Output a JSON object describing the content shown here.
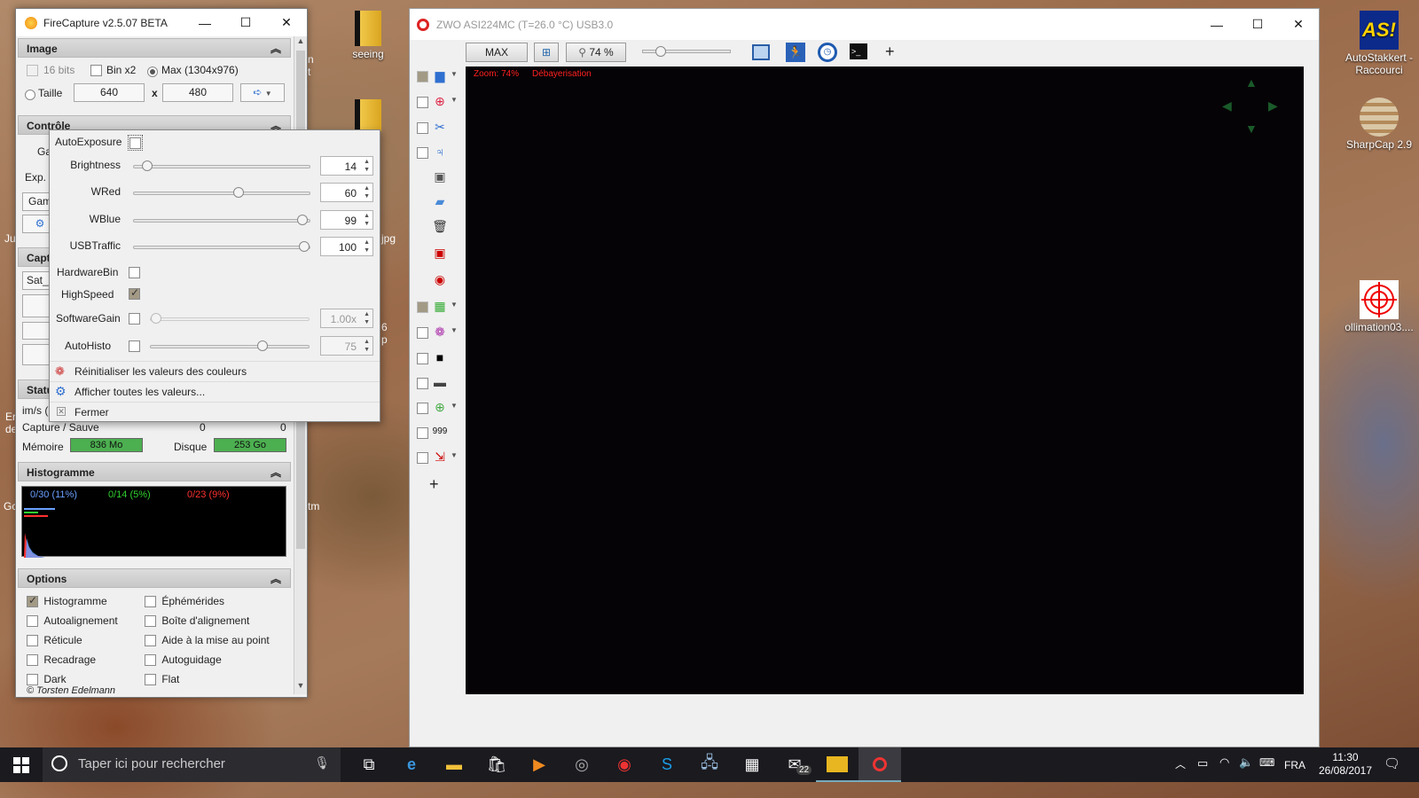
{
  "desktop": {
    "icons": [
      {
        "label": "seeing"
      },
      {
        "label": "AutoStakkert - Raccourci"
      },
      {
        "label": "SharpCap 2.9"
      },
      {
        "label": "ollimation03...."
      }
    ],
    "partial_labels": {
      "n": "n",
      "t": "t",
      "jpg": "jpg",
      "six": "6",
      "p": "p",
      "tm": "tm",
      "Ju": "Ju",
      "Er": "Er",
      "de": "de",
      "Gc": "Gc"
    }
  },
  "firecapture": {
    "title": "FireCapture v2.5.07 BETA",
    "image_section": {
      "header": "Image",
      "bits_label": "16 bits",
      "bin_label": "Bin x2",
      "max_label": "Max (1304x976)",
      "taille_label": "Taille",
      "width": "640",
      "x_label": "x",
      "height": "480"
    },
    "controle_section": {
      "header": "Contrôle",
      "ga_label": "Ga",
      "exp_label": "Exp.",
      "gam_label": "Gam"
    },
    "capture_section": {
      "header": "Capt",
      "profile": "Sat_"
    },
    "status_section": {
      "header": "Statu",
      "ims_label": "im/s (",
      "capture_label": "Capture / Sauve",
      "capture_val1": "0",
      "capture_val2": "0",
      "memoire_label": "Mémoire",
      "memoire_val": "836 Mo",
      "disque_label": "Disque",
      "disque_val": "253 Go"
    },
    "histogram_section": {
      "header": "Histogramme",
      "blue_text": "0/30 (11%)",
      "green_text": "0/14 (5%)",
      "red_text": "0/23 (9%)"
    },
    "options_section": {
      "header": "Options",
      "items": [
        {
          "label": "Histogramme",
          "checked": true
        },
        {
          "label": "Éphémérides",
          "checked": false
        },
        {
          "label": "Autoalignement",
          "checked": false
        },
        {
          "label": "Boîte d'alignement",
          "checked": false
        },
        {
          "label": "Réticule",
          "checked": false
        },
        {
          "label": "Aide à la mise au point",
          "checked": false
        },
        {
          "label": "Recadrage",
          "checked": false
        },
        {
          "label": "Autoguidage",
          "checked": false
        },
        {
          "label": "Dark",
          "checked": false
        },
        {
          "label": "Flat",
          "checked": false
        }
      ],
      "copyright": "© Torsten Edelmann"
    }
  },
  "popup": {
    "autoexposure_label": "AutoExposure",
    "rows": [
      {
        "label": "Brightness",
        "value": "14",
        "level": 0.05
      },
      {
        "label": "WRed",
        "value": "60",
        "level": 0.6
      },
      {
        "label": "WBlue",
        "value": "99",
        "level": 0.99
      },
      {
        "label": "USBTraffic",
        "value": "100",
        "level": 1.0
      }
    ],
    "hardwarebin_label": "HardwareBin",
    "highspeed_label": "HighSpeed",
    "softwaregain_label": "SoftwareGain",
    "softwaregain_value": "1.00x",
    "autohisto_label": "AutoHisto",
    "autohisto_value": "75",
    "menu": [
      {
        "label": "Réinitialiser les valeurs des couleurs"
      },
      {
        "label": "Afficher toutes les valeurs..."
      },
      {
        "label": "Fermer"
      }
    ]
  },
  "zwo": {
    "title": "ZWO ASI224MC (T=26.0 °C) USB3.0",
    "max_label": "MAX",
    "zoom_label": "74 %",
    "zoom_overlay": "Zoom: 74%",
    "debayer_overlay": "Débayerisation",
    "compass": {
      "n": "N",
      "s": "S",
      "e": "E",
      "w": "W"
    }
  },
  "taskbar": {
    "search_placeholder": "Taper ici pour rechercher",
    "mail_badge": "22",
    "language": "FRA",
    "time": "11:30",
    "date": "26/08/2017"
  },
  "colors": {
    "memory_bar": "#4caf50",
    "overlay_red": "#ff2020",
    "hist_blue": "#6aa0ff",
    "hist_green": "#30d030",
    "hist_red": "#ff3030"
  }
}
